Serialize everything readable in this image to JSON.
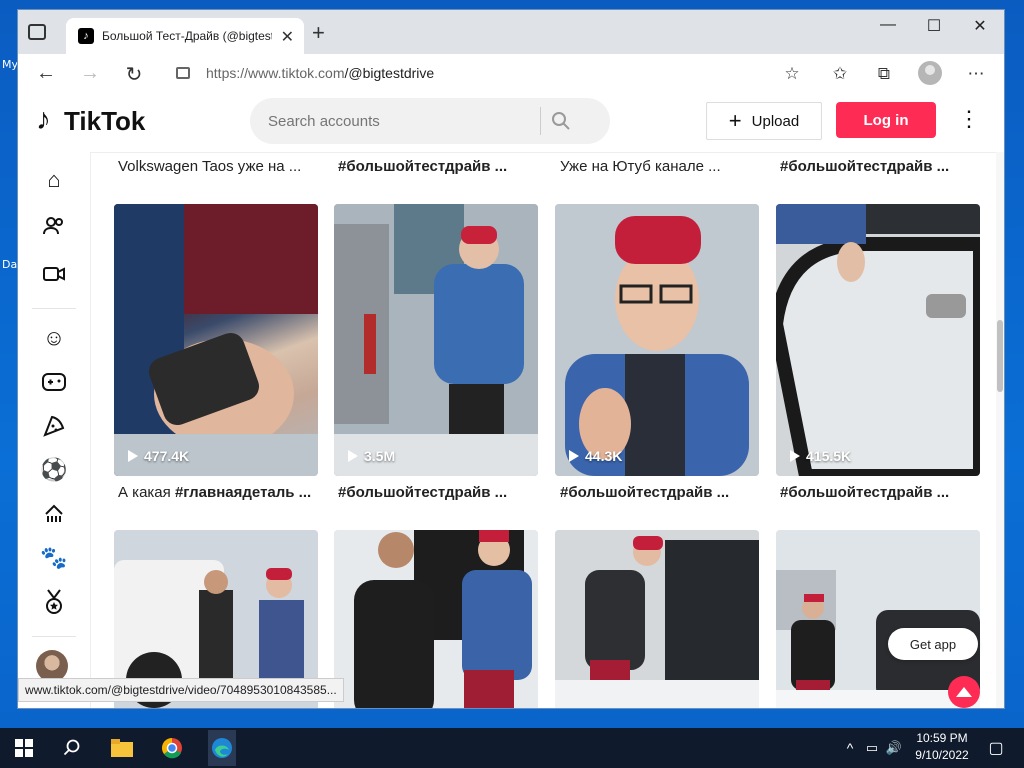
{
  "desktop": {
    "label1": "My",
    "label2": "Da"
  },
  "browser": {
    "tab_title": "Большой Тест-Драйв (@bigtest",
    "url_host": "https://www.tiktok.com",
    "url_path": "/@bigtestdrive",
    "status_url": "www.tiktok.com/@bigtestdrive/video/7048953010843585..."
  },
  "tiktok": {
    "logo": "TikTok",
    "search_placeholder": "Search accounts",
    "upload_label": "Upload",
    "login_label": "Log in",
    "get_app_label": "Get app"
  },
  "sidebar": {
    "items": [
      "home-icon",
      "following-icon",
      "live-icon",
      "comedy-icon",
      "gaming-icon",
      "food-icon",
      "sports-icon",
      "beauty-icon",
      "animals-icon",
      "achievement-icon"
    ]
  },
  "captions_top": [
    "Volkswagen Taos уже на ...",
    "#большойтестдрайв ...",
    "Уже на Ютуб канале ...",
    "#большойтестдрайв ..."
  ],
  "videos": [
    {
      "views": "477.4K",
      "caption_plain": "А какая ",
      "caption_tag": "#главнаядеталь ..."
    },
    {
      "views": "3.5M",
      "caption_plain": "",
      "caption_tag": "#большойтестдрайв ..."
    },
    {
      "views": "44.3K",
      "caption_plain": "",
      "caption_tag": "#большойтестдрайв ..."
    },
    {
      "views": "415.5K",
      "caption_plain": "",
      "caption_tag": "#большойтестдрайв ..."
    }
  ],
  "taskbar": {
    "time": "10:59 PM",
    "date": "9/10/2022"
  },
  "colors": {
    "accent": "#fe2c55",
    "desktop": "#0a63c9",
    "taskbar": "#0f1a2c"
  }
}
